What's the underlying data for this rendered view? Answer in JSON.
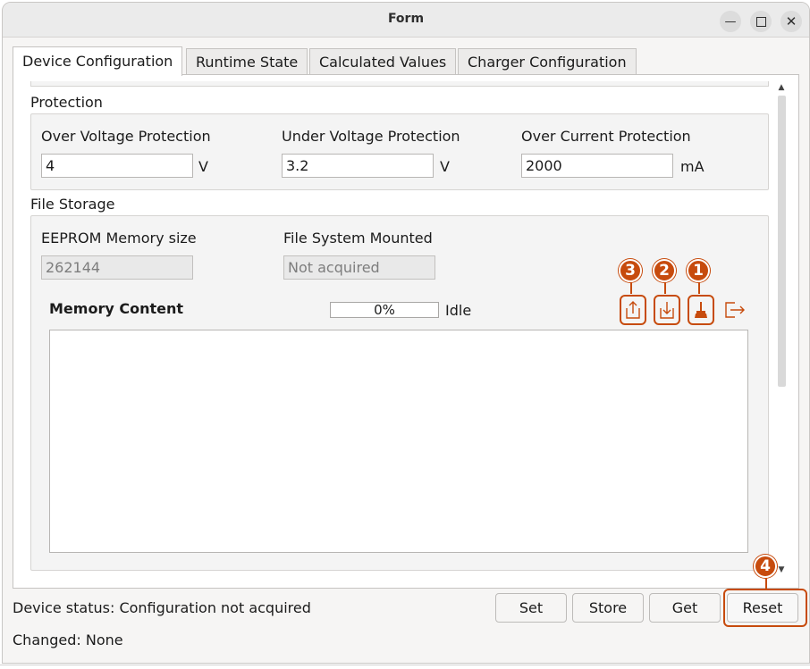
{
  "window": {
    "title": "Form"
  },
  "tabs": [
    {
      "label": "Device Configuration"
    },
    {
      "label": "Runtime State"
    },
    {
      "label": "Calculated Values"
    },
    {
      "label": "Charger Configuration"
    }
  ],
  "protection": {
    "title": "Protection",
    "over_voltage": {
      "label": "Over Voltage Protection",
      "value": "4",
      "unit": "V"
    },
    "under_voltage": {
      "label": "Under Voltage Protection",
      "value": "3.2",
      "unit": "V"
    },
    "over_current": {
      "label": "Over Current Protection",
      "value": "2000",
      "unit": "mA"
    }
  },
  "file_storage": {
    "title": "File Storage",
    "eeprom_label": "EEPROM Memory size",
    "eeprom_value": "262144",
    "fs_label": "File System Mounted",
    "fs_value": "Not acquired",
    "memory_content_label": "Memory Content",
    "progress_text": "0%",
    "progress_value": 0,
    "progress_status": "Idle",
    "icons": [
      "upload-icon",
      "download-icon",
      "broom-icon",
      "export-icon"
    ],
    "memory_text": ""
  },
  "annotations": [
    "1",
    "2",
    "3",
    "4"
  ],
  "buttons": {
    "set": "Set",
    "store": "Store",
    "get": "Get",
    "reset": "Reset"
  },
  "status": {
    "device": "Device status: Configuration not acquired",
    "changed": "Changed: None"
  },
  "colors": {
    "accent": "#c74b0d",
    "progress": "#3584e4"
  }
}
